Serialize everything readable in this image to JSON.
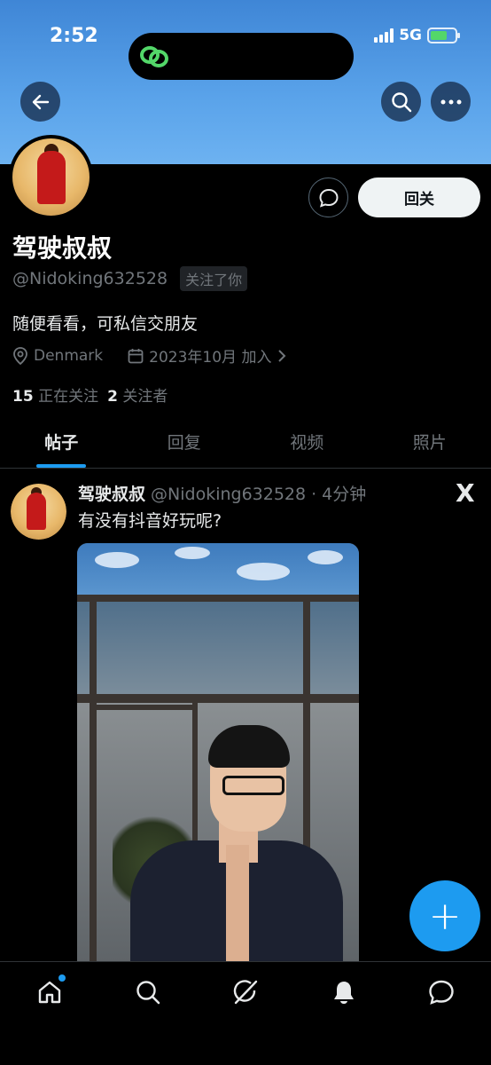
{
  "status_bar": {
    "time": "2:52",
    "network": "5G"
  },
  "profile": {
    "name": "驾驶叔叔",
    "handle": "@Nidoking632528",
    "follows_you": "关注了你",
    "bio": "随便看看，可私信交朋友",
    "location": "Denmark",
    "joined": "2023年10月 加入",
    "following_count": "15",
    "following_label": "正在关注",
    "followers_count": "2",
    "followers_label": "关注者",
    "follow_back_label": "回关"
  },
  "tabs": [
    {
      "label": "帖子",
      "active": true
    },
    {
      "label": "回复",
      "active": false
    },
    {
      "label": "视频",
      "active": false
    },
    {
      "label": "照片",
      "active": false
    }
  ],
  "post": {
    "author": "驾驶叔叔",
    "handle": "@Nidoking632528",
    "time": "4分钟",
    "separator": "·",
    "text": "有没有抖音好玩呢?",
    "source_logo": "X"
  },
  "fab_label": "+",
  "colors": {
    "accent": "#1d9bf0",
    "banner": "#5aa3ea",
    "background": "#000000"
  },
  "icons": [
    "back-arrow-icon",
    "search-icon",
    "more-icon",
    "message-icon",
    "location-icon",
    "calendar-icon",
    "chevron-right-icon",
    "home-icon",
    "explore-icon",
    "grok-icon",
    "notifications-icon",
    "messages-icon"
  ]
}
